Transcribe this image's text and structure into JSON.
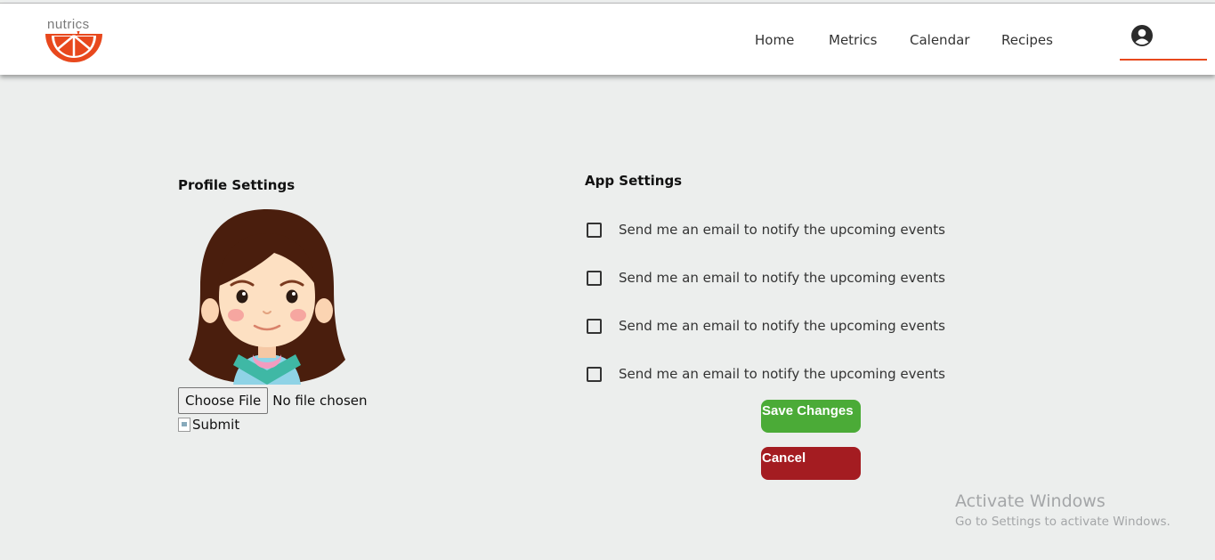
{
  "brand": {
    "logo_text": "nutrics",
    "accent_color": "#e8481d"
  },
  "nav": {
    "items": [
      "Home",
      "Metrics",
      "Calendar",
      "Recipes"
    ],
    "user_icon": "user-circle-icon"
  },
  "profile": {
    "title": "Profile Settings",
    "avatar_icon": "girl-avatar",
    "choose_file_label": "Choose File",
    "file_status": "No file chosen",
    "submit_alt": "Submit"
  },
  "app_settings": {
    "title": "App Settings",
    "options": [
      {
        "label": "Send me an email to notify the upcoming events",
        "checked": false
      },
      {
        "label": "Send me an email to notify the upcoming events",
        "checked": false
      },
      {
        "label": "Send me an email to notify the upcoming events",
        "checked": false
      },
      {
        "label": "Send me an email to notify the upcoming events",
        "checked": false
      }
    ],
    "save_label": "Save Changes",
    "cancel_label": "Cancel",
    "save_color": "#4bab37",
    "cancel_color": "#a41c21"
  },
  "watermark": {
    "title": "Activate Windows",
    "subtitle": "Go to Settings to activate Windows."
  }
}
